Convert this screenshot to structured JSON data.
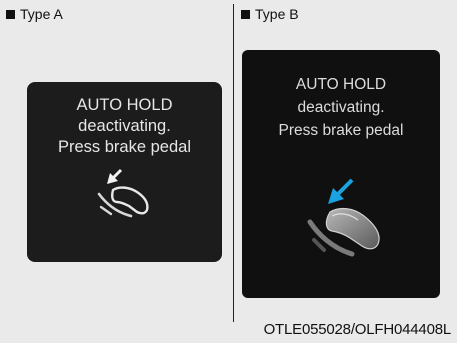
{
  "typeA": {
    "label": "Type A",
    "message": [
      "AUTO HOLD",
      "deactivating.",
      "Press brake pedal"
    ]
  },
  "typeB": {
    "label": "Type B",
    "message": [
      "AUTO HOLD",
      "deactivating.",
      "Press brake pedal"
    ]
  },
  "figure_code": "OTLE055028/OLFH044408L",
  "colors": {
    "panel_a": "#1c1c1c",
    "panel_b": "#101010",
    "arrow_b": "#1aa3e0",
    "page": "#eaeaea"
  },
  "icons": [
    "foot-pressing-pedal-icon",
    "arrow-icon"
  ]
}
